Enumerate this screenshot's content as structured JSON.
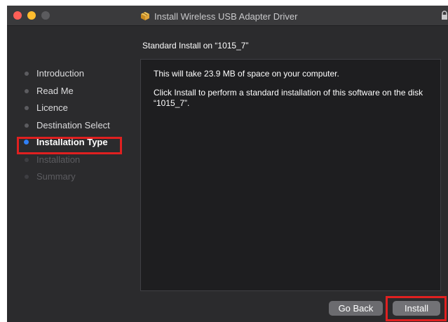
{
  "window": {
    "title": "Install Wireless USB Adapter Driver",
    "subtitle": "Standard Install on “1015_7”"
  },
  "steps": [
    {
      "label": "Introduction",
      "state": "done"
    },
    {
      "label": "Read Me",
      "state": "done"
    },
    {
      "label": "Licence",
      "state": "done"
    },
    {
      "label": "Destination Select",
      "state": "done"
    },
    {
      "label": "Installation Type",
      "state": "active"
    },
    {
      "label": "Installation",
      "state": "pending"
    },
    {
      "label": "Summary",
      "state": "pending"
    }
  ],
  "content": {
    "message1": "This will take 23.9 MB of space on your computer.",
    "message2": "Click Install to perform a standard installation of this software on the disk “1015_7”."
  },
  "buttons": {
    "go_back": "Go Back",
    "install": "Install"
  },
  "colors": {
    "accent": "#2f7ff5",
    "highlight": "#e02020",
    "close": "#ff5f57",
    "minimize": "#febc2e"
  },
  "icons": {
    "title": "package-icon",
    "lock": "lock-icon"
  }
}
